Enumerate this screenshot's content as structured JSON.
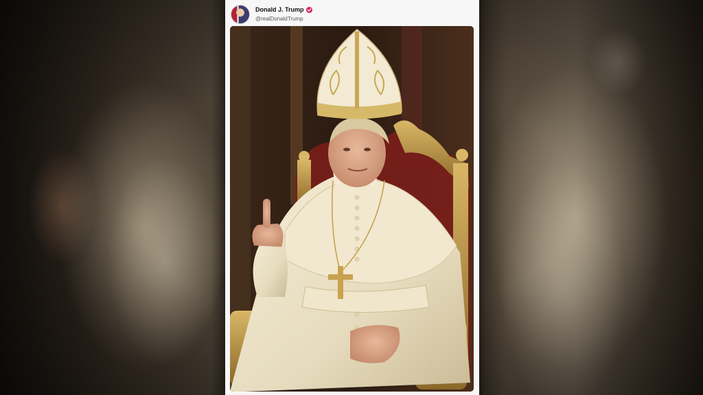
{
  "post": {
    "author": {
      "display_name": "Donald J. Trump",
      "handle": "@realDonaldTrump",
      "verified": true,
      "avatar_icon": "flag-portrait-avatar"
    },
    "image": {
      "subject": "figure-in-papal-vestments-on-throne"
    }
  },
  "colors": {
    "card_background": "#f7f7f7",
    "verified_badge": "#e0245e",
    "vestment": "#efe6cc",
    "gold": "#b8913f"
  }
}
